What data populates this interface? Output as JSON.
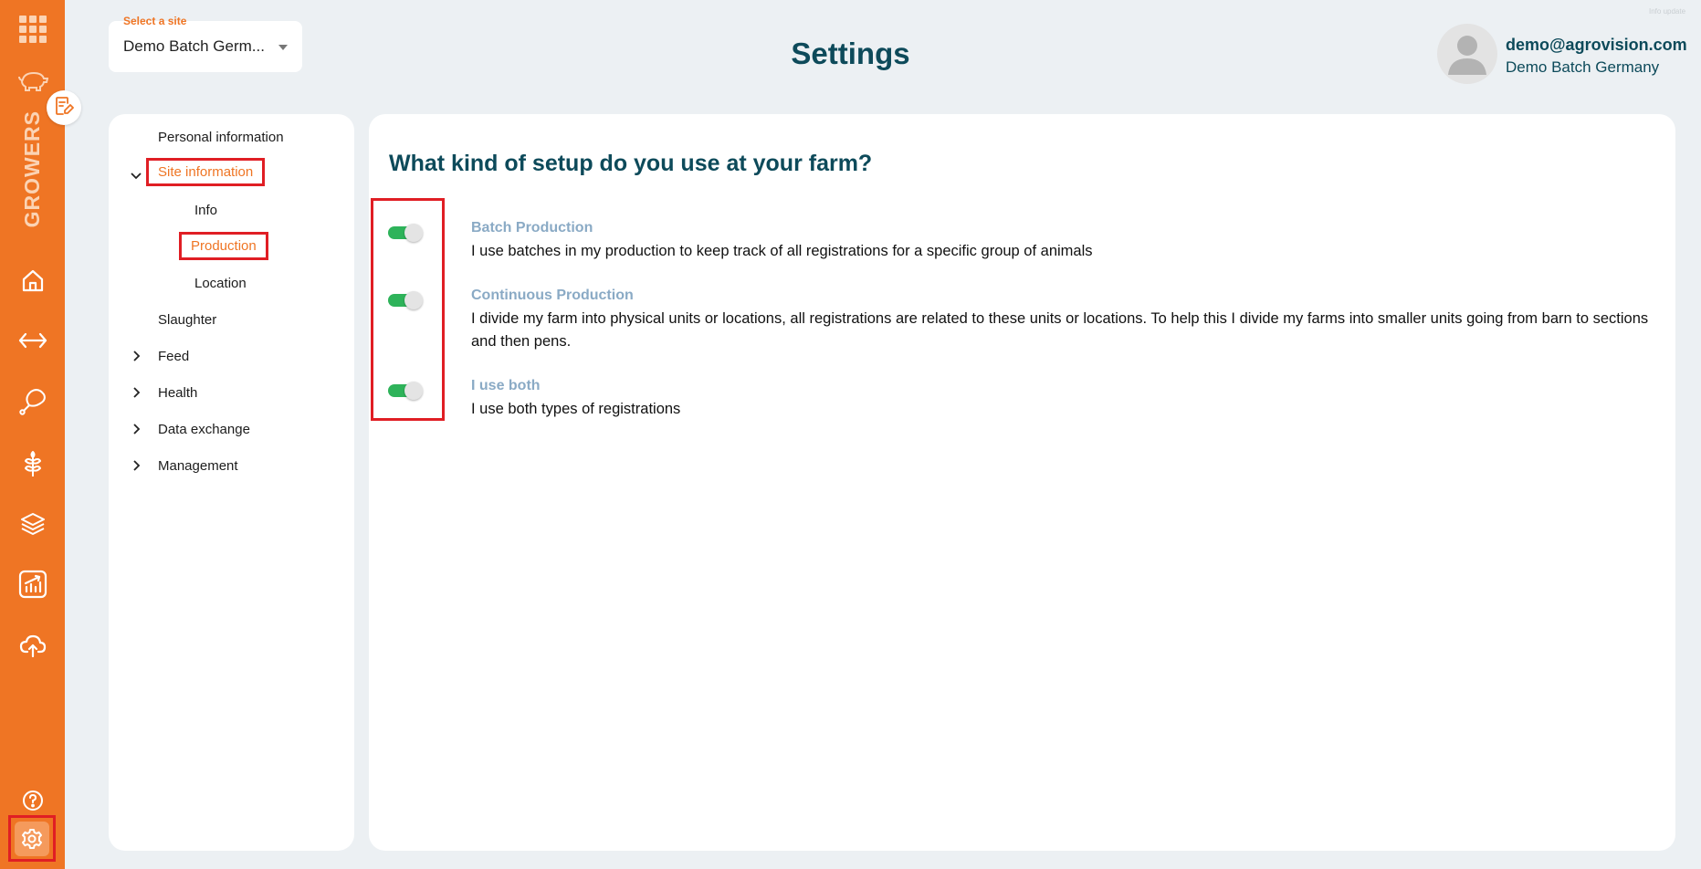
{
  "rail": {
    "brand_text": "GROWERS",
    "icons": [
      "apps-grid-icon",
      "pig-icon",
      "edit-note-icon",
      "home-icon",
      "transfer-arrows-icon",
      "meat-leg-icon",
      "grain-icon",
      "layers-icon",
      "chart-icon",
      "cloud-upload-icon",
      "help-icon",
      "settings-icon"
    ],
    "accent_color": "#ef7524"
  },
  "header": {
    "site_select_label": "Select a site",
    "site_select_value": "Demo Batch Germ...",
    "title": "Settings",
    "user_email": "demo@agrovision.com",
    "user_site": "Demo Batch Germany",
    "corner_text": "Info update"
  },
  "menu": {
    "personal_information": "Personal information",
    "site_information": "Site information",
    "info": "Info",
    "production": "Production",
    "location": "Location",
    "slaughter": "Slaughter",
    "feed": "Feed",
    "health": "Health",
    "data_exchange": "Data exchange",
    "management": "Management"
  },
  "content": {
    "question": "What kind of setup do you use at your farm?",
    "options": [
      {
        "title": "Batch Production",
        "description": "I use batches in my production to keep track of all registrations for a specific group of animals",
        "enabled": true
      },
      {
        "title": "Continuous Production",
        "description": "I divide my farm into physical units or locations, all registrations are related to these units or locations. To help this I divide my farms into smaller units going from barn to sections and then pens.",
        "enabled": true
      },
      {
        "title": "I use both",
        "description": "I use both types of registrations",
        "enabled": true
      }
    ],
    "toggle_on_color": "#2eb35a"
  }
}
